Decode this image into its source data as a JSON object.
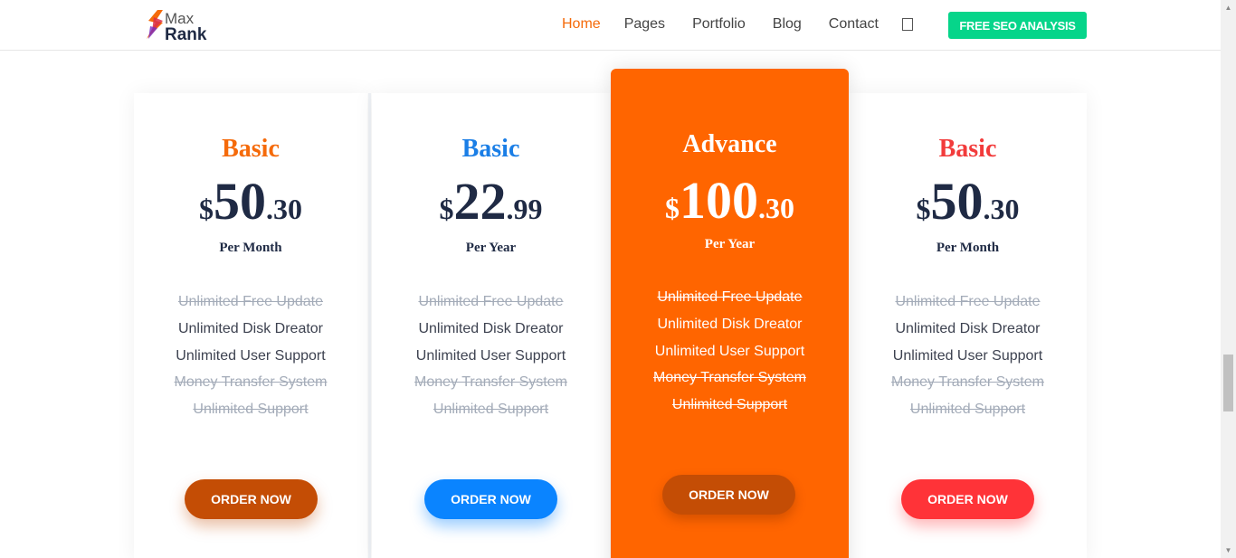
{
  "logo": {
    "line1": "Max",
    "line2": "Rank"
  },
  "nav": {
    "items": [
      {
        "label": "Home",
        "active": true,
        "dropdown": false
      },
      {
        "label": "Pages",
        "dropdown": true
      },
      {
        "label": "Portfolio",
        "dropdown": true
      },
      {
        "label": "Blog",
        "dropdown": true
      },
      {
        "label": "Contact",
        "dropdown": false
      }
    ],
    "caret_glyph": "",
    "search_icon": "search-icon",
    "cta_label": "FREE SEO ANALYSIS",
    "cta_color": "#06d58a",
    "active_color": "#f56a0a"
  },
  "plans": [
    {
      "name": "Basic",
      "name_color": "#f56a0a",
      "currency": "$",
      "price_int": "50",
      "price_dec": ".30",
      "period": "Per Month",
      "features": [
        {
          "text": "Unlimited Free Update",
          "included": false
        },
        {
          "text": "Unlimited Disk Dreator",
          "included": true
        },
        {
          "text": "Unlimited User Support",
          "included": true
        },
        {
          "text": "Money Transfer System",
          "included": false
        },
        {
          "text": "Unlimited Support",
          "included": false
        }
      ],
      "button": "ORDER NOW",
      "button_color": "#c44d05"
    },
    {
      "name": "Basic",
      "name_color": "#1a7ee6",
      "currency": "$",
      "price_int": "22",
      "price_dec": ".99",
      "period": "Per Year",
      "features": [
        {
          "text": "Unlimited Free Update",
          "included": false
        },
        {
          "text": "Unlimited Disk Dreator",
          "included": true
        },
        {
          "text": "Unlimited User Support",
          "included": true
        },
        {
          "text": "Money Transfer System",
          "included": false
        },
        {
          "text": "Unlimited Support",
          "included": false
        }
      ],
      "button": "ORDER NOW",
      "button_color": "#0a84ff"
    },
    {
      "name": "Advance",
      "name_color": "#ffffff",
      "currency": "$",
      "price_int": "100",
      "price_dec": ".30",
      "period": "Per Year",
      "features": [
        {
          "text": "Unlimited Free Update",
          "included": false
        },
        {
          "text": "Unlimited Disk Dreator",
          "included": true
        },
        {
          "text": "Unlimited User Support",
          "included": true
        },
        {
          "text": "Money Transfer System",
          "included": false
        },
        {
          "text": "Unlimited Support",
          "included": false
        }
      ],
      "button": "ORDER NOW",
      "button_color": "#c44d05",
      "background": "#ff6500"
    },
    {
      "name": "Basic",
      "name_color": "#f23b3b",
      "currency": "$",
      "price_int": "50",
      "price_dec": ".30",
      "period": "Per Month",
      "features": [
        {
          "text": "Unlimited Free Update",
          "included": false
        },
        {
          "text": "Unlimited Disk Dreator",
          "included": true
        },
        {
          "text": "Unlimited User Support",
          "included": true
        },
        {
          "text": "Money Transfer System",
          "included": false
        },
        {
          "text": "Unlimited Support",
          "included": false
        }
      ],
      "button": "ORDER NOW",
      "button_color": "#ff3338"
    }
  ]
}
